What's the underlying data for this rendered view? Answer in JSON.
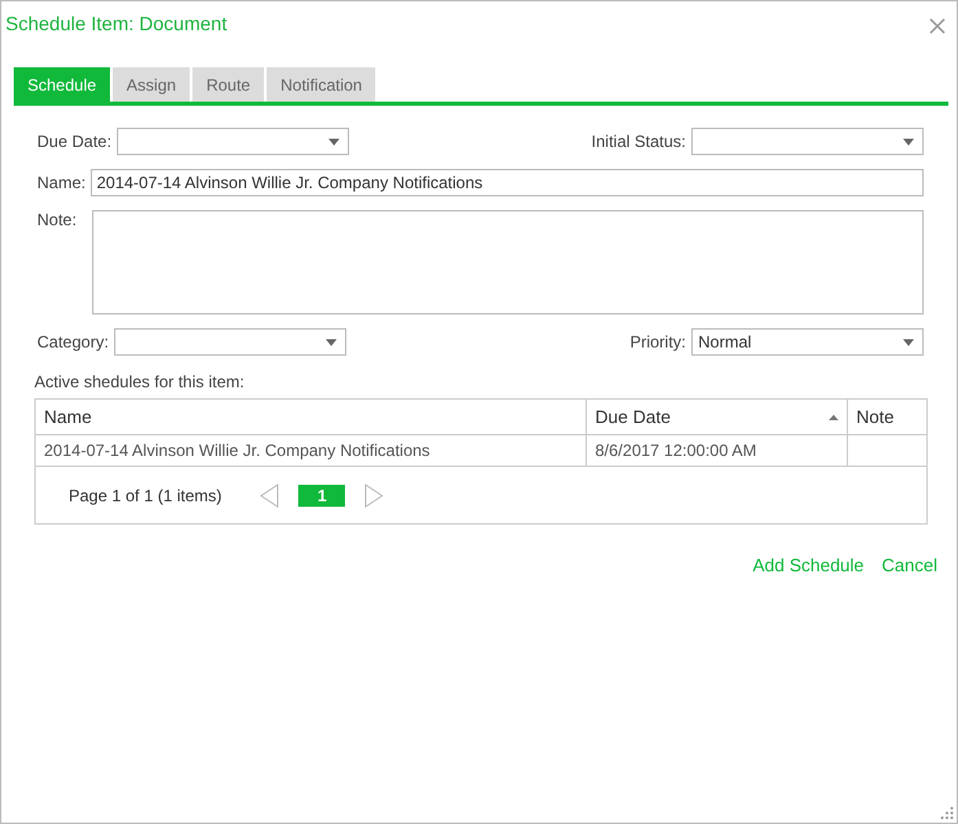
{
  "window": {
    "title": "Schedule Item: Document"
  },
  "tabs": [
    {
      "label": "Schedule",
      "selected": true
    },
    {
      "label": "Assign",
      "selected": false
    },
    {
      "label": "Route",
      "selected": false
    },
    {
      "label": "Notification",
      "selected": false
    }
  ],
  "form": {
    "due_date": {
      "label": "Due Date:"
    },
    "initial_status": {
      "label": "Initial Status:"
    },
    "name": {
      "label": "Name:",
      "value": "2014-07-14 Alvinson Willie Jr. Company Notifications"
    },
    "note": {
      "label": "Note:"
    },
    "category": {
      "label": "Category:"
    },
    "priority": {
      "label": "Priority:",
      "value": "Normal"
    }
  },
  "schedules": {
    "caption": "Active shedules for this item:",
    "columns": [
      {
        "label": "Name",
        "sorted": false
      },
      {
        "label": "Due Date",
        "sorted": true
      },
      {
        "label": "Note",
        "sorted": false
      }
    ],
    "rows": [
      {
        "cells": [
          "2014-07-14 Alvinson Willie Jr. Company Notifications",
          "8/6/2017 12:00:00 AM",
          null
        ]
      }
    ],
    "pager": {
      "info": "Page 1 of 1 (1 items)",
      "pages": [
        {
          "label": "1",
          "selected": true
        }
      ]
    }
  },
  "actions": [
    "Add Schedule",
    "Cancel"
  ]
}
